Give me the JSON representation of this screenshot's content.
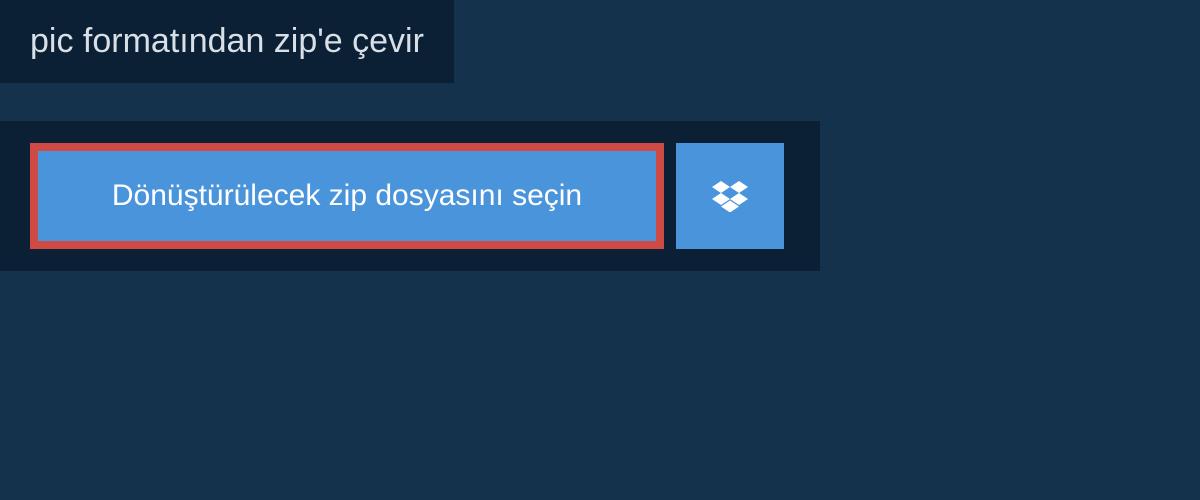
{
  "header": {
    "title": "pic formatından zip'e çevir"
  },
  "actions": {
    "select_file_label": "Dönüştürülecek zip dosyasını seçin",
    "dropbox_icon": "dropbox-icon"
  },
  "colors": {
    "bg_outer": "#15324d",
    "bg_inner": "#0c2035",
    "button_bg": "#4a94db",
    "button_border": "#d04a45",
    "text_light": "#ffffff",
    "text_muted": "#d8dfe6"
  }
}
